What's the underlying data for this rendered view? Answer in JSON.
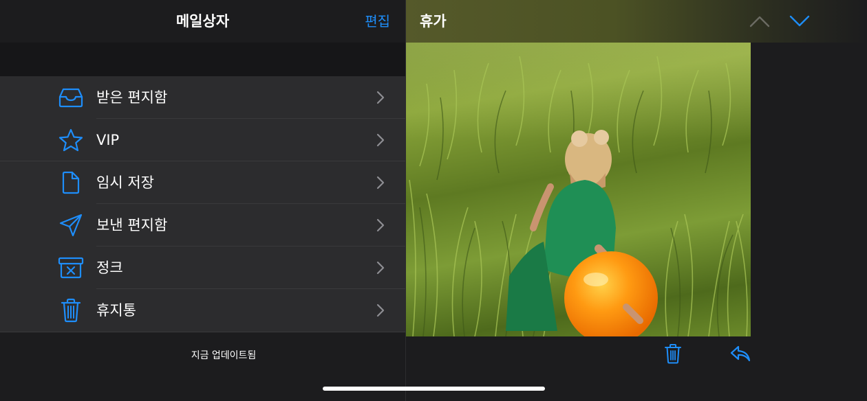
{
  "sidebar": {
    "title": "메일상자",
    "edit_label": "편집",
    "mailboxes": [
      {
        "label": "받은 편지함",
        "icon": "inbox-icon"
      },
      {
        "label": "VIP",
        "icon": "star-icon"
      },
      {
        "label": "임시 저장",
        "icon": "document-icon"
      },
      {
        "label": "보낸 편지함",
        "icon": "paper-plane-icon"
      },
      {
        "label": "정크",
        "icon": "junk-box-icon"
      },
      {
        "label": "휴지통",
        "icon": "trash-icon"
      }
    ],
    "status": "지금 업데이트됨"
  },
  "message": {
    "subject": "휴가",
    "attachment_icon": "photo-image"
  },
  "colors": {
    "accent": "#1e8efb",
    "background": "#1c1c1e",
    "row": "#2c2c2e"
  }
}
